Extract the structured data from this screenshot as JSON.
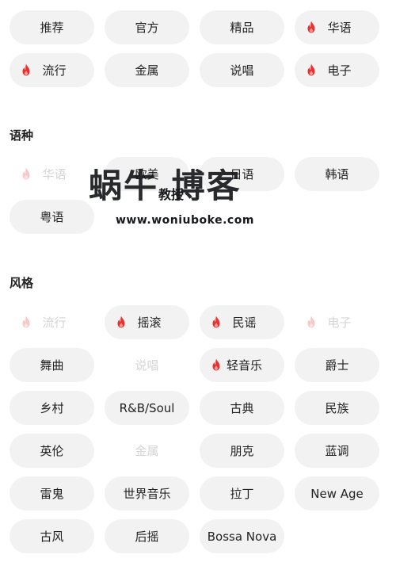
{
  "top_tags": [
    {
      "label": "推荐",
      "hot": false,
      "faded": false
    },
    {
      "label": "官方",
      "hot": false,
      "faded": false
    },
    {
      "label": "精品",
      "hot": false,
      "faded": false
    },
    {
      "label": "华语",
      "hot": true,
      "faded": false
    },
    {
      "label": "流行",
      "hot": true,
      "faded": false
    },
    {
      "label": "金属",
      "hot": false,
      "faded": false
    },
    {
      "label": "说唱",
      "hot": false,
      "faded": false
    },
    {
      "label": "电子",
      "hot": true,
      "faded": false
    }
  ],
  "sections": {
    "language": {
      "title": "语种",
      "tags": [
        {
          "label": "华语",
          "hot": true,
          "faded": true
        },
        {
          "label": "欧美",
          "hot": false,
          "faded": false
        },
        {
          "label": "日语",
          "hot": false,
          "faded": false
        },
        {
          "label": "韩语",
          "hot": false,
          "faded": false
        },
        {
          "label": "粤语",
          "hot": false,
          "faded": false
        }
      ]
    },
    "style": {
      "title": "风格",
      "tags": [
        {
          "label": "流行",
          "hot": true,
          "faded": true
        },
        {
          "label": "摇滚",
          "hot": true,
          "faded": false
        },
        {
          "label": "民谣",
          "hot": true,
          "faded": false
        },
        {
          "label": "电子",
          "hot": true,
          "faded": true
        },
        {
          "label": "舞曲",
          "hot": false,
          "faded": false
        },
        {
          "label": "说唱",
          "hot": false,
          "faded": true
        },
        {
          "label": "轻音乐",
          "hot": true,
          "faded": false
        },
        {
          "label": "爵士",
          "hot": false,
          "faded": false
        },
        {
          "label": "乡村",
          "hot": false,
          "faded": false
        },
        {
          "label": "R&B/Soul",
          "hot": false,
          "faded": false
        },
        {
          "label": "古典",
          "hot": false,
          "faded": false
        },
        {
          "label": "民族",
          "hot": false,
          "faded": false
        },
        {
          "label": "英伦",
          "hot": false,
          "faded": false
        },
        {
          "label": "金属",
          "hot": false,
          "faded": true
        },
        {
          "label": "朋克",
          "hot": false,
          "faded": false
        },
        {
          "label": "蓝调",
          "hot": false,
          "faded": false
        },
        {
          "label": "雷鬼",
          "hot": false,
          "faded": false
        },
        {
          "label": "世界音乐",
          "hot": false,
          "faded": false
        },
        {
          "label": "拉丁",
          "hot": false,
          "faded": false
        },
        {
          "label": "New Age",
          "hot": false,
          "faded": false
        },
        {
          "label": "古风",
          "hot": false,
          "faded": false
        },
        {
          "label": "后摇",
          "hot": false,
          "faded": false
        },
        {
          "label": "Bossa Nova",
          "hot": false,
          "faded": false
        }
      ]
    }
  },
  "watermark": {
    "main": "蜗牛  博客",
    "small": "教授",
    "url": "www.woniuboke.com"
  },
  "colors": {
    "pill_bg": "#f2f2f2",
    "flame": "#e8322f",
    "flame_faded": "#f6c9c8",
    "text": "#222222",
    "text_faded": "#d4d4d4"
  },
  "icons": {
    "hot": "flame-icon"
  }
}
